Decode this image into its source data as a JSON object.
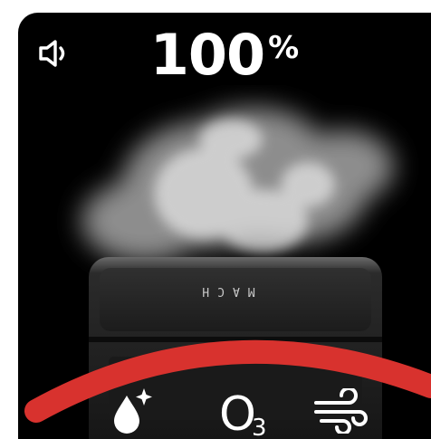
{
  "status": {
    "battery_value": "100",
    "battery_unit": "%"
  },
  "device": {
    "brand": "MACH"
  },
  "modes": [
    {
      "name": "humidify",
      "icon": "water-drop-sparkle-icon"
    },
    {
      "name": "ozone",
      "icon": "ozone-icon",
      "label_main": "O",
      "label_sub": "3"
    },
    {
      "name": "airflow",
      "icon": "wind-icon"
    }
  ],
  "colors": {
    "background": "#000000",
    "accent_arc": "#d8322e",
    "text": "#ffffff"
  }
}
